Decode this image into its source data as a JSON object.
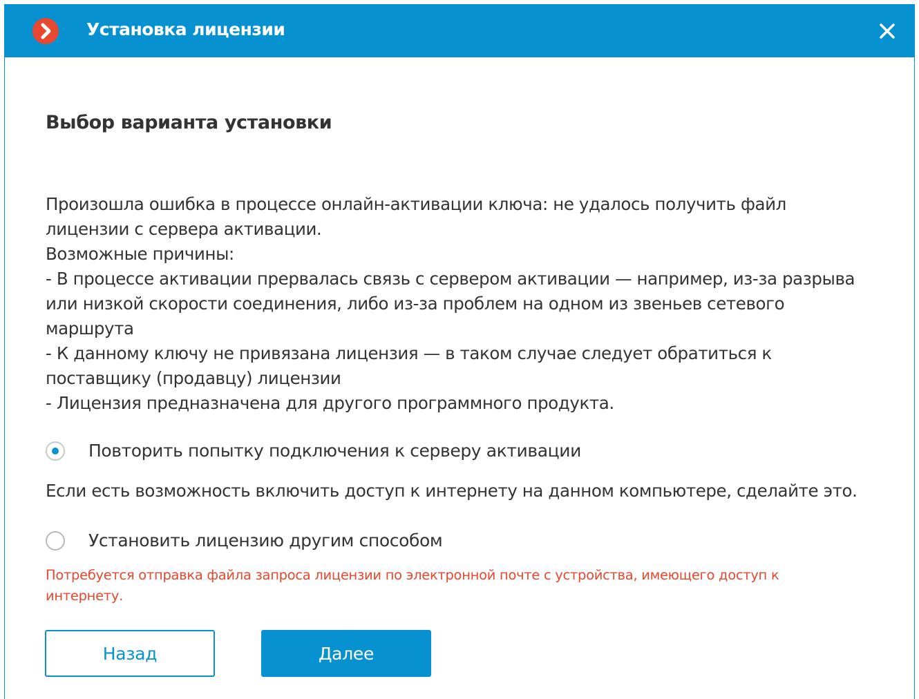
{
  "window": {
    "title": "Установка лицензии"
  },
  "section_title": "Выбор варианта установки",
  "message_lines": [
    "Произошла ошибка в процессе онлайн-активации ключа: не удалось получить файл",
    "лицензии с сервера активации.",
    "Возможные причины:",
    "- В процессе активации прервалась связь с сервером активации — например, из-за разрыва",
    "или низкой скорости соединения, либо из-за проблем на одном из звеньев сетевого",
    "маршрута",
    "- К данному ключу не привязана лицензия — в таком случае следует обратиться к",
    "поставщику (продавцу) лицензии",
    "- Лицензия предназначена для другого программного продукта."
  ],
  "options": {
    "retry": {
      "label": "Повторить попытку подключения к серверу активации",
      "checked": true,
      "hint": "Если есть возможность включить доступ к интернету на данном компьютере, сделайте это."
    },
    "other": {
      "label": "Установить лицензию другим способом",
      "checked": false,
      "warning_lines": [
        "Потребуется отправка файла запроса лицензии по электронной почте с устройства, имеющего доступ к",
        "интернету."
      ]
    }
  },
  "buttons": {
    "back": "Назад",
    "next": "Далее"
  },
  "colors": {
    "accent": "#0791d1",
    "warning": "#e8482f",
    "app_icon": "#e8482f",
    "text": "#333333"
  },
  "icons": {
    "app": "chevron-right-circle-icon",
    "close": "close-icon"
  }
}
